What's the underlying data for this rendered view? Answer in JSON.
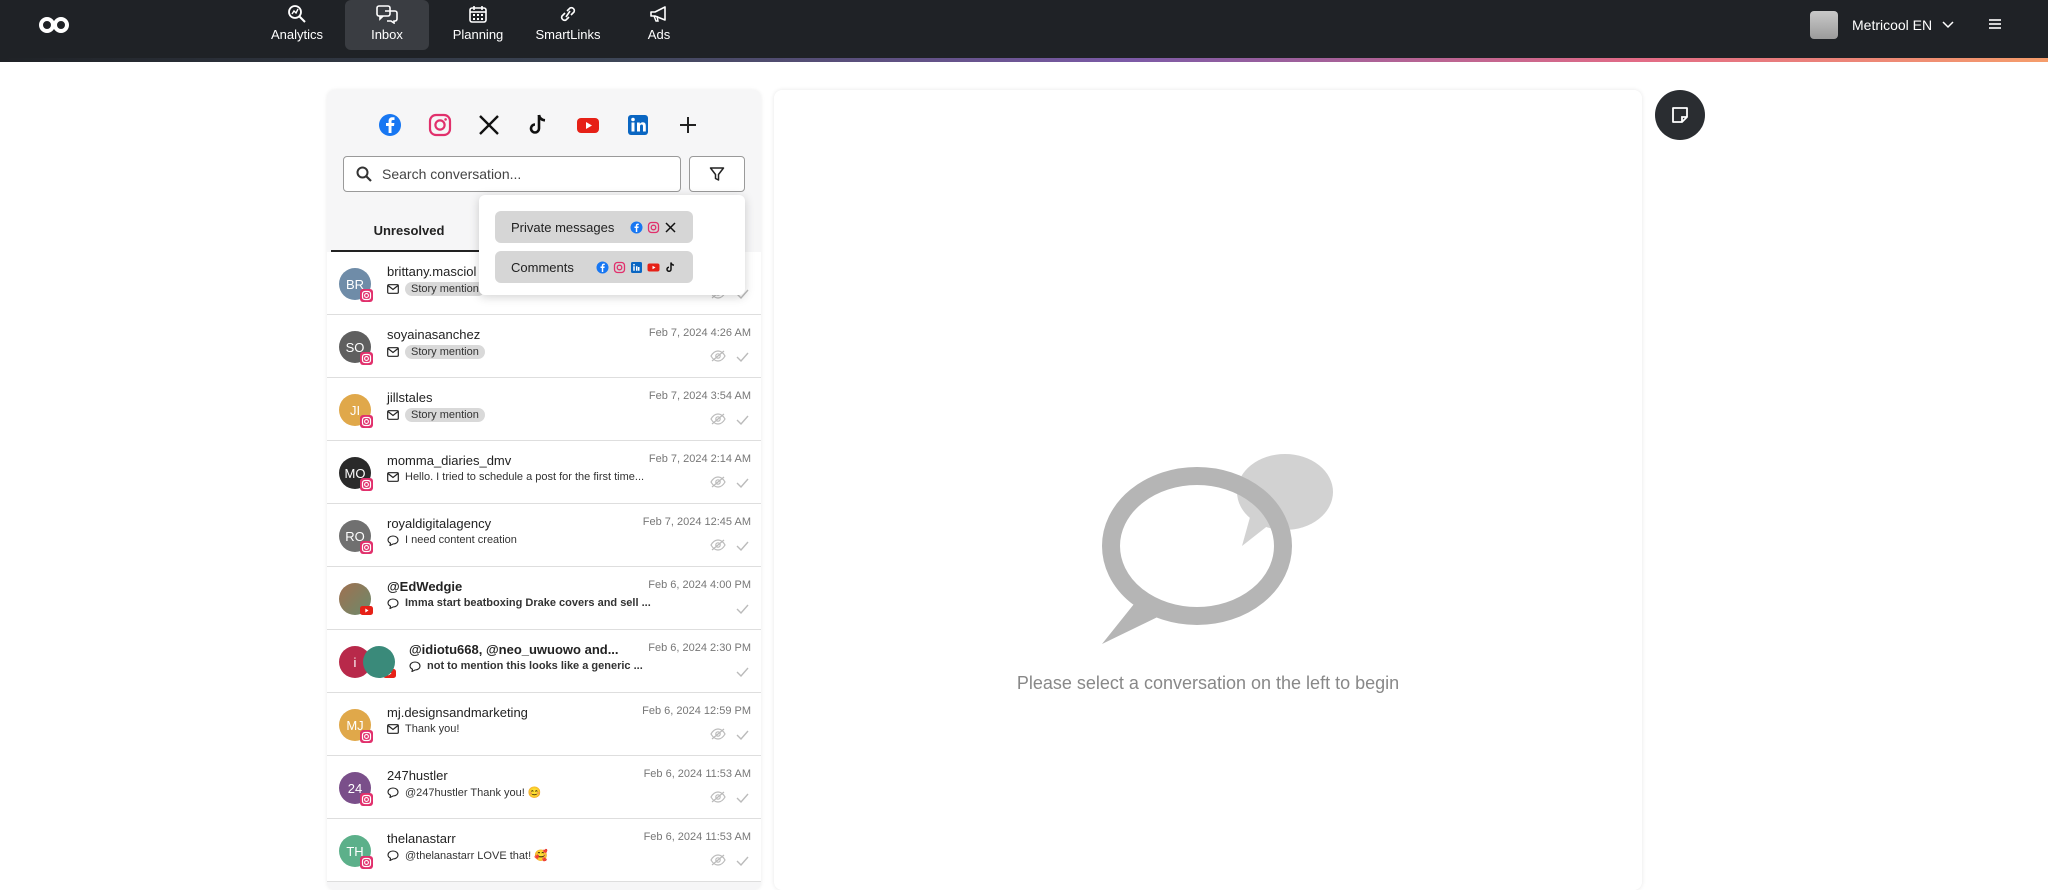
{
  "nav": {
    "items": [
      {
        "label": "Analytics",
        "icon": "analytics-icon"
      },
      {
        "label": "Inbox",
        "icon": "inbox-icon"
      },
      {
        "label": "Planning",
        "icon": "calendar-icon"
      },
      {
        "label": "SmartLinks",
        "icon": "link-icon"
      },
      {
        "label": "Ads",
        "icon": "megaphone-icon"
      }
    ],
    "active": "Inbox"
  },
  "user": {
    "name": "Metricool EN"
  },
  "inbox": {
    "networks": [
      "facebook",
      "instagram",
      "x",
      "tiktok",
      "youtube",
      "linkedin",
      "add"
    ],
    "search_placeholder": "Search conversation...",
    "tab_unresolved": "Unresolved",
    "filter_menu": {
      "private_messages": "Private messages",
      "comments": "Comments"
    },
    "conversations": [
      {
        "initials": "BR",
        "name": "brittany.masciol",
        "preview": "Story mention",
        "is_tag": true,
        "type": "message",
        "time": "",
        "network": "instagram"
      },
      {
        "initials": "SO",
        "name": "soyainasanchez",
        "preview": "Story mention",
        "is_tag": true,
        "type": "message",
        "time": "Feb 7, 2024 4:26 AM",
        "network": "instagram"
      },
      {
        "initials": "JI",
        "name": "jillstales",
        "preview": "Story mention",
        "is_tag": true,
        "type": "message",
        "time": "Feb 7, 2024 3:54 AM",
        "network": "instagram"
      },
      {
        "initials": "MO",
        "name": "momma_diaries_dmv",
        "preview": "Hello.  I tried to schedule a post for the first time...",
        "is_tag": false,
        "type": "message",
        "time": "Feb 7, 2024 2:14 AM",
        "network": "instagram"
      },
      {
        "initials": "RO",
        "name": "royaldigitalagency",
        "preview": "I need content creation",
        "is_tag": false,
        "type": "comment",
        "time": "Feb 7, 2024 12:45 AM",
        "network": "instagram"
      },
      {
        "initials": "",
        "name": "@EdWedgie",
        "preview": "Imma start beatboxing Drake covers and sell ...",
        "is_tag": false,
        "type": "comment",
        "time": "Feb 6, 2024 4:00 PM",
        "network": "youtube",
        "bold": true
      },
      {
        "initials": "i",
        "name": "@idiotu668, @neo_uwuowo and...",
        "preview": "not to mention this looks like a generic ...",
        "is_tag": false,
        "type": "comment",
        "time": "Feb 6, 2024 2:30 PM",
        "network": "youtube",
        "bold": true
      },
      {
        "initials": "MJ",
        "name": "mj.designsandmarketing",
        "preview": "Thank you!",
        "is_tag": false,
        "type": "message",
        "time": "Feb 6, 2024 12:59 PM",
        "network": "instagram"
      },
      {
        "initials": "24",
        "name": "247hustler",
        "preview": "@247hustler Thank you! 😊",
        "is_tag": false,
        "type": "comment",
        "time": "Feb 6, 2024 11:53 AM",
        "network": "instagram"
      },
      {
        "initials": "TH",
        "name": "thelanastarr",
        "preview": "@thelanastarr LOVE that! 🥰",
        "is_tag": false,
        "type": "comment",
        "time": "Feb 6, 2024 11:53 AM",
        "network": "instagram"
      }
    ]
  },
  "main": {
    "empty_text": "Please select a conversation on the left to begin"
  },
  "colors": {
    "facebook": "#1877f2",
    "instagram": "#e1306c",
    "youtube": "#e62117",
    "linkedin": "#0a66c2",
    "topbar": "#1f2226"
  }
}
